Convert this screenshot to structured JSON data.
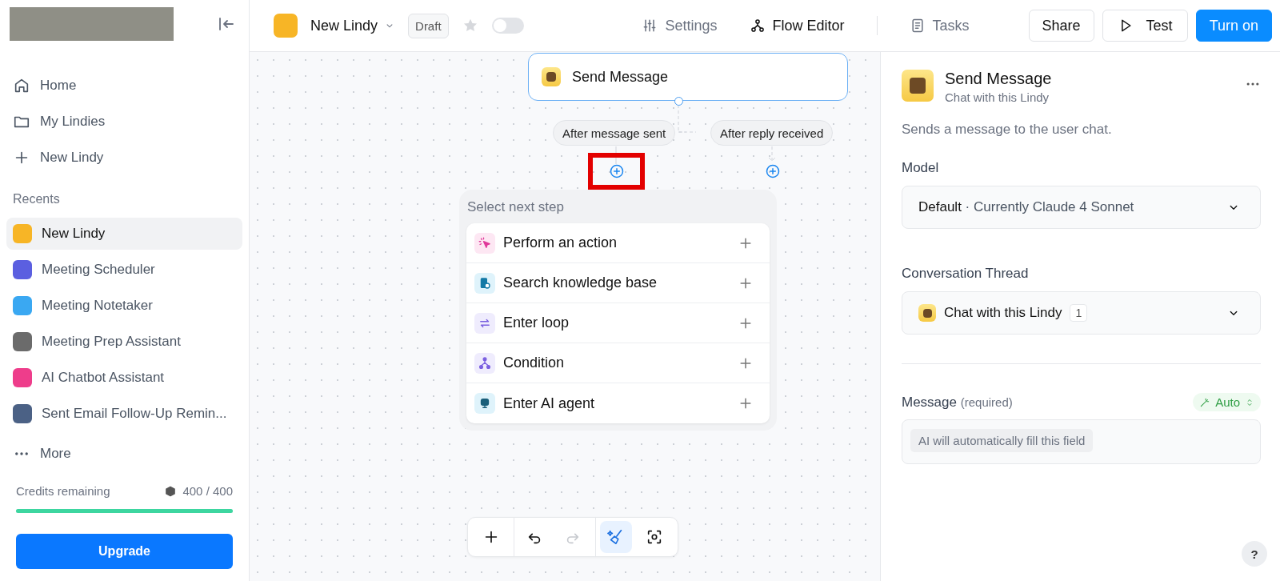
{
  "sidebar": {
    "nav": [
      {
        "kind": "home",
        "label": "Home"
      },
      {
        "kind": "folder",
        "label": "My Lindies"
      },
      {
        "kind": "plus",
        "label": "New Lindy"
      }
    ],
    "recents_title": "Recents",
    "recents": [
      {
        "label": "New Lindy",
        "color": "#f7b526",
        "selected": true
      },
      {
        "label": "Meeting Scheduler",
        "color": "#5b5fe0",
        "selected": false
      },
      {
        "label": "Meeting Notetaker",
        "color": "#3aa8f2",
        "selected": false
      },
      {
        "label": "Meeting Prep Assistant",
        "color": "#6b6b6b",
        "selected": false
      },
      {
        "label": "AI Chatbot Assistant",
        "color": "#ee3d8b",
        "selected": false
      },
      {
        "label": "Sent Email Follow-Up Remin...",
        "color": "#4b6185",
        "selected": false
      }
    ],
    "more": "More",
    "credits": {
      "label": "Credits remaining",
      "value": "400 / 400",
      "level": 1
    },
    "upgrade": "Upgrade"
  },
  "header": {
    "title": "New Lindy",
    "badge": "Draft",
    "starred": false,
    "toggle_on": false,
    "tabs": [
      {
        "kind": "sliders",
        "label": "Settings",
        "selected": false
      },
      {
        "kind": "flow",
        "label": "Flow Editor",
        "selected": true
      },
      {
        "kind": "doc",
        "label": "Tasks",
        "selected": false
      }
    ],
    "buttons": [
      {
        "kind": "outline",
        "label": "Share"
      },
      {
        "kind": "play",
        "label": "Test"
      },
      {
        "kind": "primary",
        "label": "Turn on"
      }
    ]
  },
  "canvas": {
    "node": {
      "title": "Send Message"
    },
    "branches": [
      {
        "label": "After message sent",
        "highlighted": true
      },
      {
        "label": "After reply received",
        "highlighted": false
      }
    ],
    "menu": {
      "title": "Select next step",
      "items": [
        {
          "kind": "action",
          "label": "Perform an action"
        },
        {
          "kind": "knowledge",
          "label": "Search knowledge base"
        },
        {
          "kind": "loop",
          "label": "Enter loop"
        },
        {
          "kind": "condition",
          "label": "Condition"
        },
        {
          "kind": "agent",
          "label": "Enter AI agent"
        }
      ]
    },
    "toolbar": [
      {
        "kind": "add",
        "disabled": false,
        "selected": false
      },
      {
        "kind": "undo",
        "disabled": false,
        "selected": false
      },
      {
        "kind": "redo",
        "disabled": true,
        "selected": false
      },
      {
        "kind": "tidy",
        "disabled": false,
        "selected": true
      },
      {
        "kind": "focus",
        "disabled": false,
        "selected": false
      }
    ]
  },
  "panel": {
    "title": "Send Message",
    "subtitle": "Chat with this Lindy",
    "description": "Sends a message to the user chat.",
    "model": {
      "label": "Model",
      "value": "Default",
      "detail": "· Currently Claude 4 Sonnet"
    },
    "thread": {
      "label": "Conversation Thread",
      "value": "Chat with this Lindy",
      "count": "1"
    },
    "message": {
      "label": "Message",
      "hint": "(required)",
      "mode": "Auto",
      "placeholder": "AI will automatically fill this field"
    },
    "help": "?"
  }
}
